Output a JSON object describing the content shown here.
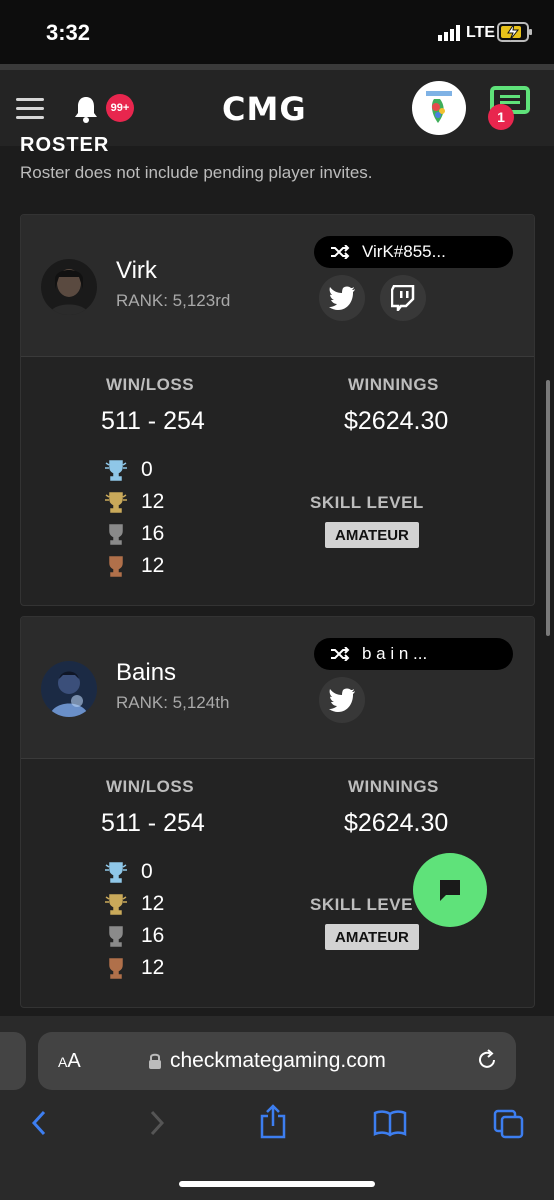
{
  "status": {
    "time": "3:32",
    "network": "LTE"
  },
  "nav": {
    "notifications_badge": "99+",
    "logo": "CMG",
    "chat_badge": "1"
  },
  "roster": {
    "title": "ROSTER",
    "subtitle": "Roster does not include pending player invites."
  },
  "players": [
    {
      "name": "Virk",
      "rank": "RANK: 5,123rd",
      "gamertag": "VirK#855...",
      "socials": [
        "twitter",
        "twitch"
      ],
      "win_loss_label": "WIN/LOSS",
      "win_loss": "511 - 254",
      "winnings_label": "WINNINGS",
      "winnings": "$2624.30",
      "trophies": {
        "diamond": "0",
        "gold": "12",
        "silver": "16",
        "bronze": "12"
      },
      "skill_label": "SKILL LEVEL",
      "skill": "AMATEUR"
    },
    {
      "name": "Bains",
      "rank": "RANK: 5,124th",
      "gamertag": "b a i n ...",
      "socials": [
        "twitter"
      ],
      "win_loss_label": "WIN/LOSS",
      "win_loss": "511 - 254",
      "winnings_label": "WINNINGS",
      "winnings": "$2624.30",
      "trophies": {
        "diamond": "0",
        "gold": "12",
        "silver": "16",
        "bronze": "12"
      },
      "skill_label": "SKILL LEVE",
      "skill": "AMATEUR"
    }
  ],
  "browser": {
    "aa_small": "A",
    "aa_large": "A",
    "url": "checkmategaming.com"
  },
  "colors": {
    "accent_green": "#5fe27a",
    "badge_red": "#e8264e",
    "twitter": "#ffffff"
  }
}
